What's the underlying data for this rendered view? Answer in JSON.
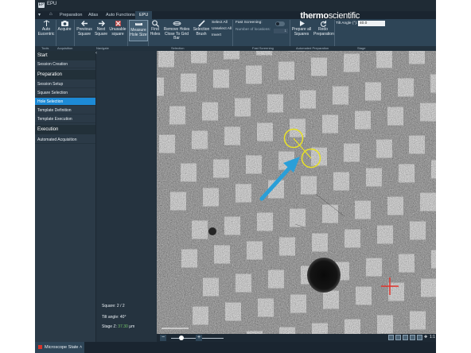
{
  "app": {
    "title": "EPU",
    "brand_bold": "thermo",
    "brand_light": "scientific"
  },
  "tabs": [
    "Preparation",
    "Atlas",
    "Auto Functions",
    "EPU"
  ],
  "active_tab": "EPU",
  "ribbon": {
    "auto_eucentric": "Auto\nEucentric",
    "acquire": "Acquire",
    "previous_square": "Previous\nSquare",
    "next_square": "Next\nSquare",
    "unusable_square": "Unusable\nsquare",
    "measure_hole_size": "Measure\nHole Size",
    "find_holes": "Find\nHoles",
    "remove_holes": "Remove Holes\nClose To Grid Bar",
    "selection_brush": "Selection\nBrush",
    "select_all": "Select All",
    "unselect_all": "Unselect All",
    "invert": "Invert",
    "fast_screening": "Fast Screening:",
    "number_of_locations_label": "Number of locations:",
    "number_of_locations_value": "1",
    "prepare_all_squares": "Prepare all\nSquares",
    "redo_preparation": "Redo\nPreparation",
    "tilt_angle_label": "Tilt Angle (°):",
    "tilt_angle_value": "40.0"
  },
  "groups": {
    "tools": "Tools",
    "acquisition": "Acquisition",
    "navigate": "Navigate",
    "selection": "Selection",
    "fast_screening": "Fast Screening",
    "automated_preparation": "Automated Preparation",
    "stage": "Stage"
  },
  "sidebar": {
    "start": "Start",
    "session_creation": "Session Creation",
    "preparation": "Preparation",
    "items": [
      "Session Setup",
      "Square Selection",
      "Hole Selection",
      "Template Definition",
      "Template Execution"
    ],
    "active_item": "Hole Selection",
    "execution": "Execution",
    "automated_acquisition": "Automated Acquisition"
  },
  "info": {
    "square_label": "Square:",
    "square_value": "2 / 2",
    "tilt_label": "Tilt angle:",
    "tilt_value": "40°",
    "stage_label": "Stage Z:",
    "stage_value": "37.30",
    "stage_unit": "μm"
  },
  "footer": {
    "zoom_minus": "−",
    "zoom_plus": "+",
    "ratio": "1:1"
  },
  "status": {
    "microscope_state": "Microscope State"
  },
  "colors": {
    "accent_blue": "#1d8ad6",
    "measure_circle": "#e9e224",
    "arrow": "#2a9fd8",
    "target_cross": "#e0322a"
  }
}
